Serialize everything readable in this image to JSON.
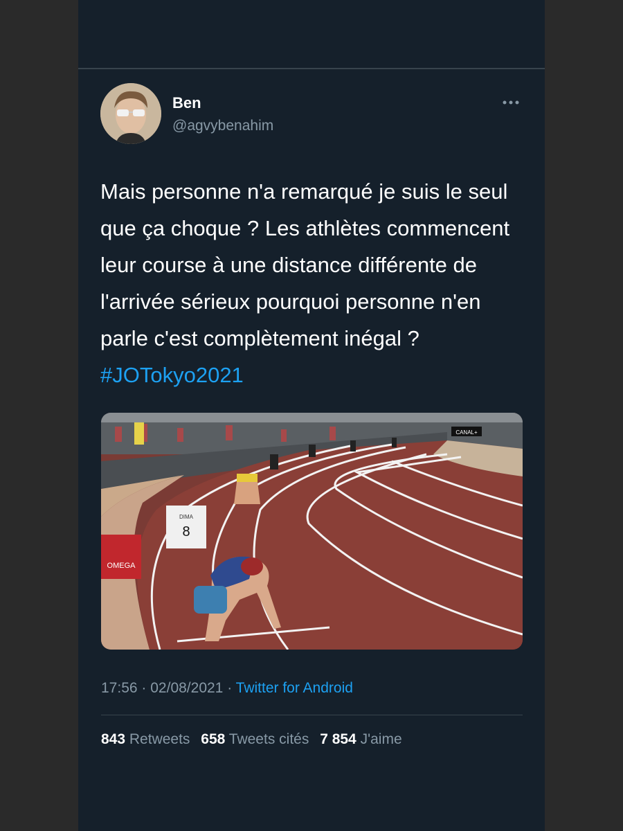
{
  "tweet": {
    "author_name": "Ben",
    "author_handle": "@agvybenahim",
    "more_icon": "more-horizontal-icon",
    "text": "Mais personne n'a remarqué je suis le seul que ça choque ? Les athlètes commencent leur course à une distance différente de l'arrivée sérieux pourquoi personne n'en parle c'est complètement inégal ?",
    "hashtag": "#JOTokyo2021",
    "image": {
      "lane_number_label": "8",
      "lane_sign_brand": "DIMA",
      "broadcaster_label": "CANAL+",
      "sponsor_label": "OMEGA"
    },
    "time": "17:56",
    "date": "02/08/2021",
    "separator": "·",
    "source": "Twitter for Android"
  },
  "stats": {
    "retweets_count": "843",
    "retweets_label": "Retweets",
    "quotes_count": "658",
    "quotes_label": "Tweets cités",
    "likes_count": "7 854",
    "likes_label": "J'aime"
  },
  "colors": {
    "background": "#15202b",
    "text": "#ffffff",
    "secondary": "#8899a6",
    "accent": "#1da1f2",
    "track": "#8a3f37"
  }
}
